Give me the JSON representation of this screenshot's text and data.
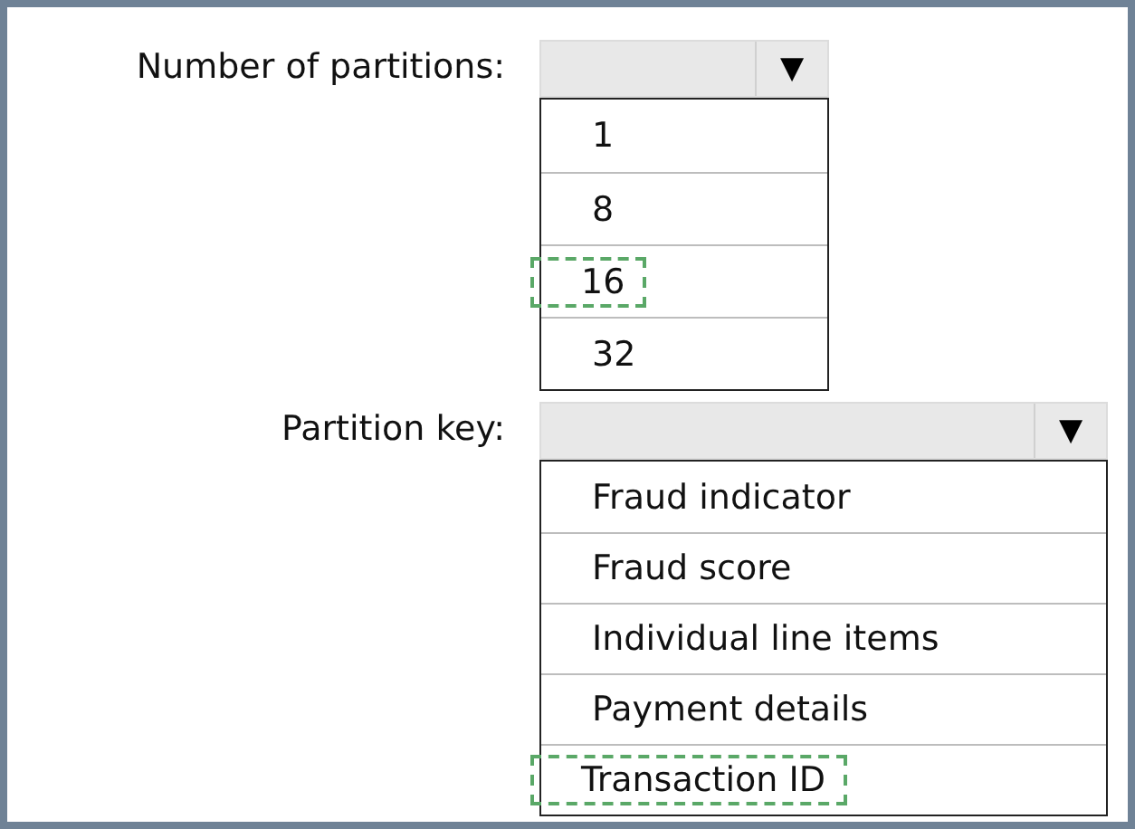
{
  "fields": [
    {
      "label": "Number of partitions:",
      "arrow": "▼",
      "options": [
        {
          "label": "1",
          "selected": false
        },
        {
          "label": "8",
          "selected": false
        },
        {
          "label": "16",
          "selected": true
        },
        {
          "label": "32",
          "selected": false
        }
      ]
    },
    {
      "label": "Partition key:",
      "arrow": "▼",
      "options": [
        {
          "label": "Fraud indicator",
          "selected": false
        },
        {
          "label": "Fraud score",
          "selected": false
        },
        {
          "label": "Individual line items",
          "selected": false
        },
        {
          "label": "Payment details",
          "selected": false
        },
        {
          "label": "Transaction ID",
          "selected": true
        }
      ]
    }
  ]
}
